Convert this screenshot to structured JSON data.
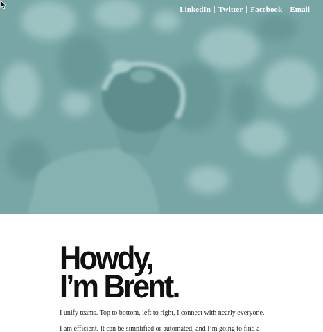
{
  "nav": {
    "links": [
      {
        "label": "LinkedIn"
      },
      {
        "label": "Twitter"
      },
      {
        "label": "Facebook"
      },
      {
        "label": "Email"
      }
    ]
  },
  "hero": {
    "tint_color": "#78a6a6"
  },
  "main": {
    "headline_line1": "Howdy,",
    "headline_line2": "I’m Brent.",
    "paragraphs": [
      "I unify teams. Top to bottom, left to right, I connect with nearly everyone.",
      "I am efficient. It can be simplified or automated, and I’m going to find a"
    ]
  }
}
